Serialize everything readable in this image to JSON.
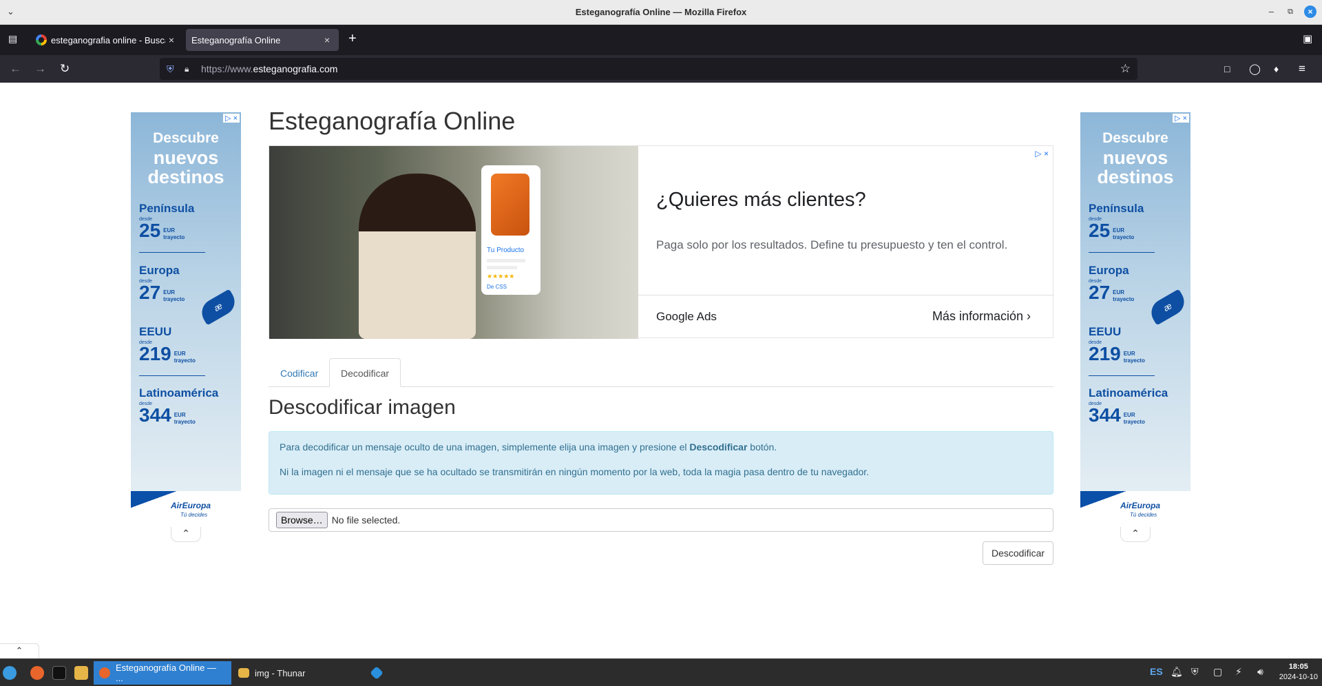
{
  "window": {
    "title": "Esteganografía Online — Mozilla Firefox"
  },
  "tabs": [
    {
      "label": "esteganografia online - Busca"
    },
    {
      "label": "Esteganografía Online"
    }
  ],
  "navbar": {
    "url_prefix": "https://www.",
    "url_domain": "esteganografia.com"
  },
  "page": {
    "title": "Esteganografía Online",
    "section_title": "Descodificar imagen",
    "tabs": [
      {
        "label": "Codificar",
        "active": false
      },
      {
        "label": "Decodificar",
        "active": true
      }
    ],
    "alert": {
      "line1_before": "Para decodificar un mensaje oculto de una imagen, simplemente elija una imagen y presione el ",
      "line1_bold": "Descodificar",
      "line1_after": " botón.",
      "line2": "Ni la imagen ni el mensaje que se ha ocultado se transmitirán en ningún momento por la web, toda la magia pasa dentro de tu navegador."
    },
    "file_input": {
      "browse_label": "Browse…",
      "status": "No file selected."
    },
    "decode_button": "Descodificar"
  },
  "top_ad": {
    "headline": "¿Quieres más clientes?",
    "subtext": "Paga solo por los resultados. Define tu presupuesto y ten el control.",
    "brand": "Google Ads",
    "cta": "Más información",
    "card_label": "Tu Producto",
    "card_footer": "De CSS"
  },
  "side_ad": {
    "line1": "Descubre",
    "line2": "nuevos",
    "line3": "destinos",
    "from_label": "desde",
    "unit_label": "EUR",
    "unit_sub": "trayecto",
    "destinations": [
      {
        "name": "Península",
        "price": "25"
      },
      {
        "name": "Europa",
        "price": "27"
      },
      {
        "name": "EEUU",
        "price": "219"
      },
      {
        "name": "Latinoamérica",
        "price": "344"
      }
    ],
    "brand": "AirEuropa",
    "tagline": "Tú decides"
  },
  "taskbar": {
    "tasks": [
      {
        "label": "Esteganografía Online — ..."
      },
      {
        "label": "img - Thunar"
      }
    ],
    "language": "ES",
    "time": "18:05",
    "date": "2024-10-10"
  }
}
